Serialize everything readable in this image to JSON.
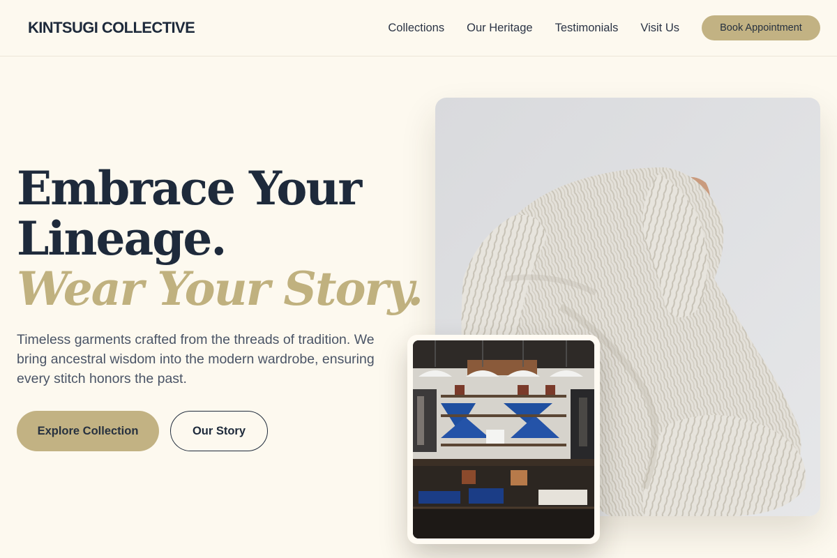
{
  "brand": {
    "name": "KINTSUGI COLLECTIVE"
  },
  "nav": {
    "links": [
      "Collections",
      "Our Heritage",
      "Testimonials",
      "Visit Us"
    ],
    "cta": "Book Appointment"
  },
  "hero": {
    "title_line1": "Embrace Your",
    "title_line2": "Lineage.",
    "title_accent": "Wear Your Story.",
    "subtitle": "Timeless garments crafted from the threads of tradition. We bring ancestral wisdom into the modern wardrobe, ensuring every stitch honors the past.",
    "primary_button": "Explore Collection",
    "secondary_button": "Our Story"
  },
  "colors": {
    "background": "#fdf9ef",
    "navy": "#1e2a3b",
    "gold": "#c2b283",
    "gold_text": "#c0b17f"
  }
}
